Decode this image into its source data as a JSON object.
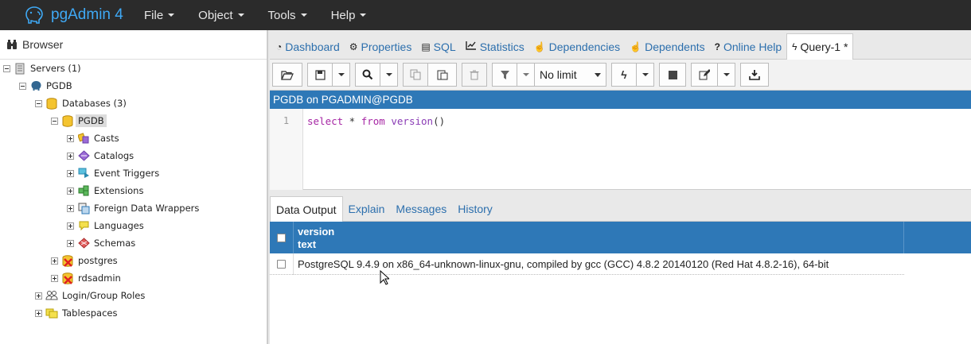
{
  "app": {
    "name": "pgAdmin 4"
  },
  "menu": [
    {
      "label": "File"
    },
    {
      "label": "Object"
    },
    {
      "label": "Tools"
    },
    {
      "label": "Help"
    }
  ],
  "browser": {
    "title": "Browser",
    "tree": [
      {
        "label": "Servers (1)",
        "icon": "servers-icon"
      },
      {
        "label": "PGDB",
        "icon": "elephant-server-icon"
      },
      {
        "label": "Databases (3)",
        "icon": "databases-icon"
      },
      {
        "label": "PGDB",
        "icon": "database-icon",
        "selected": true
      },
      {
        "label": "Casts",
        "icon": "casts-icon"
      },
      {
        "label": "Catalogs",
        "icon": "catalogs-icon"
      },
      {
        "label": "Event Triggers",
        "icon": "event-triggers-icon"
      },
      {
        "label": "Extensions",
        "icon": "extensions-icon"
      },
      {
        "label": "Foreign Data Wrappers",
        "icon": "fdw-icon"
      },
      {
        "label": "Languages",
        "icon": "languages-icon"
      },
      {
        "label": "Schemas",
        "icon": "schemas-icon"
      },
      {
        "label": "postgres",
        "icon": "database-disconnected-icon"
      },
      {
        "label": "rdsadmin",
        "icon": "database-disconnected-icon"
      },
      {
        "label": "Login/Group Roles",
        "icon": "roles-icon"
      },
      {
        "label": "Tablespaces",
        "icon": "tablespaces-icon"
      }
    ]
  },
  "tabs": [
    {
      "label": "Dashboard",
      "icon": "dashboard-icon"
    },
    {
      "label": "Properties",
      "icon": "gears-icon"
    },
    {
      "label": "SQL",
      "icon": "file-icon"
    },
    {
      "label": "Statistics",
      "icon": "line-chart-icon"
    },
    {
      "label": "Dependencies",
      "icon": "hand-icon"
    },
    {
      "label": "Dependents",
      "icon": "hand-icon"
    },
    {
      "label": "Online Help",
      "icon": "question-icon"
    },
    {
      "label": "Query-1 *",
      "icon": "bolt-icon",
      "active": true
    }
  ],
  "toolbar": {
    "limit": "No limit"
  },
  "query": {
    "connection": "PGDB on PGADMIN@PGDB",
    "line_number": "1",
    "sql": {
      "kw1": "select",
      "star": " * ",
      "kw2": "from",
      "fn": " version",
      "paren": "()"
    }
  },
  "output_tabs": [
    {
      "label": "Data Output",
      "active": true
    },
    {
      "label": "Explain"
    },
    {
      "label": "Messages"
    },
    {
      "label": "History"
    }
  ],
  "result": {
    "column_name": "version",
    "column_type": "text",
    "rows": [
      "PostgreSQL 9.4.9 on x86_64-unknown-linux-gnu, compiled by gcc (GCC) 4.8.2 20140120 (Red Hat 4.8.2-16), 64-bit"
    ]
  },
  "colors": {
    "accent": "#2e78b7",
    "link": "#2c6fad",
    "topbar": "#2b2b2b",
    "brand": "#3fa9f5"
  }
}
